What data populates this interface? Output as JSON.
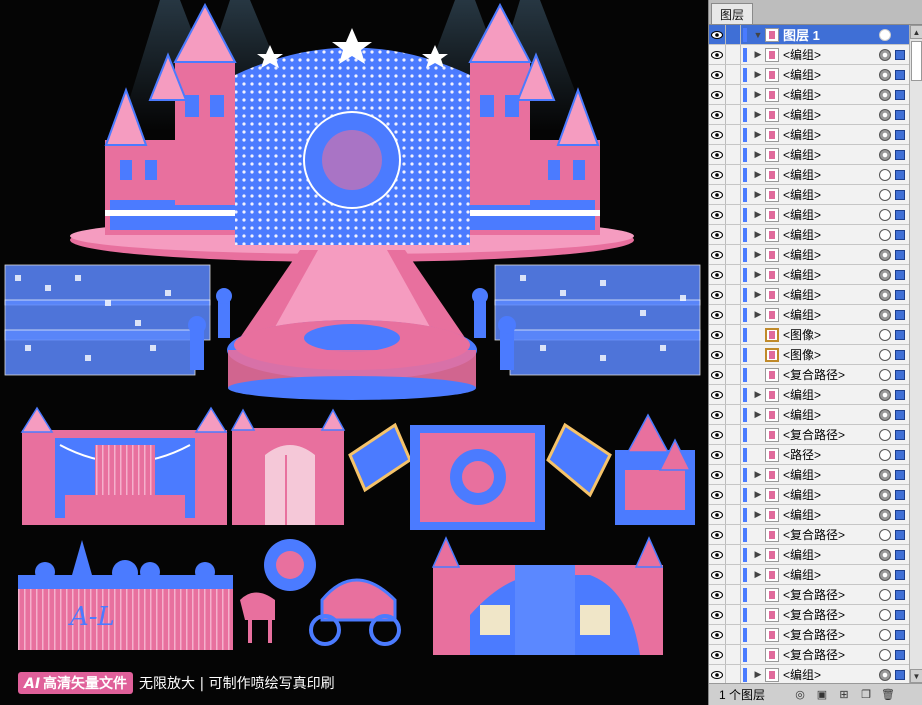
{
  "banner": {
    "badge_ai": "AI",
    "badge_text": "高清矢量文件",
    "tagline": "无限放大 | 可制作喷绘写真印刷"
  },
  "colors": {
    "pink": "#e8709e",
    "blue": "#4b7bff",
    "white": "#ffffff",
    "canvas": "#050505"
  },
  "layers_panel": {
    "tab": "图层",
    "top_layer": {
      "name": "图层 1"
    },
    "rows": [
      {
        "label": "<编组>",
        "expand": true,
        "target": "filled"
      },
      {
        "label": "<编组>",
        "expand": true,
        "target": "filled"
      },
      {
        "label": "<编组>",
        "expand": true,
        "target": "filled"
      },
      {
        "label": "<编组>",
        "expand": true,
        "target": "filled"
      },
      {
        "label": "<编组>",
        "expand": true,
        "target": "filled"
      },
      {
        "label": "<编组>",
        "expand": true,
        "target": "filled"
      },
      {
        "label": "<编组>",
        "expand": true,
        "target": "hollow"
      },
      {
        "label": "<编组>",
        "expand": true,
        "target": "hollow"
      },
      {
        "label": "<编组>",
        "expand": true,
        "target": "hollow"
      },
      {
        "label": "<编组>",
        "expand": true,
        "target": "hollow"
      },
      {
        "label": "<编组>",
        "expand": true,
        "target": "filled"
      },
      {
        "label": "<编组>",
        "expand": true,
        "target": "filled"
      },
      {
        "label": "<编组>",
        "expand": true,
        "target": "filled"
      },
      {
        "label": "<编组>",
        "expand": true,
        "target": "filled"
      },
      {
        "label": "<图像>",
        "expand": false,
        "target": "hollow",
        "thumb": "img"
      },
      {
        "label": "<图像>",
        "expand": false,
        "target": "hollow",
        "thumb": "img"
      },
      {
        "label": "<复合路径>",
        "expand": false,
        "target": "hollow"
      },
      {
        "label": "<编组>",
        "expand": true,
        "target": "filled"
      },
      {
        "label": "<编组>",
        "expand": true,
        "target": "filled"
      },
      {
        "label": "<复合路径>",
        "expand": false,
        "target": "hollow"
      },
      {
        "label": "<路径>",
        "expand": false,
        "target": "hollow"
      },
      {
        "label": "<编组>",
        "expand": true,
        "target": "filled"
      },
      {
        "label": "<编组>",
        "expand": true,
        "target": "filled"
      },
      {
        "label": "<编组>",
        "expand": true,
        "target": "filled"
      },
      {
        "label": "<复合路径>",
        "expand": false,
        "target": "hollow"
      },
      {
        "label": "<编组>",
        "expand": true,
        "target": "filled"
      },
      {
        "label": "<编组>",
        "expand": true,
        "target": "filled"
      },
      {
        "label": "<复合路径>",
        "expand": false,
        "target": "hollow"
      },
      {
        "label": "<复合路径>",
        "expand": false,
        "target": "hollow"
      },
      {
        "label": "<复合路径>",
        "expand": false,
        "target": "hollow"
      },
      {
        "label": "<复合路径>",
        "expand": false,
        "target": "hollow"
      },
      {
        "label": "<编组>",
        "expand": true,
        "target": "filled"
      }
    ],
    "footer": {
      "count": "1 个图层"
    }
  }
}
